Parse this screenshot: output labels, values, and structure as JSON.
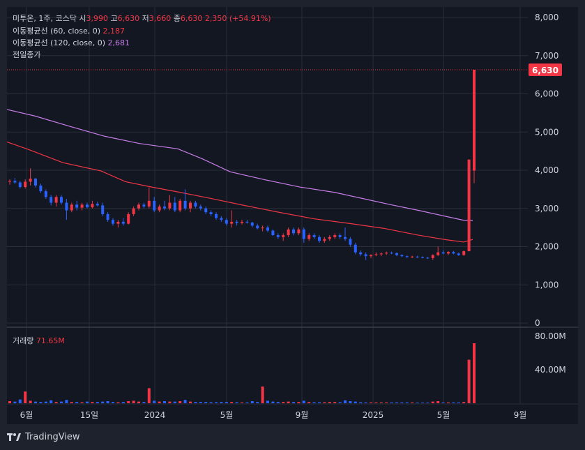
{
  "legend": {
    "symbol": "미투온, 1주, 코스닥",
    "o_label": "시",
    "o": "3,990",
    "h_label": "고",
    "h": "6,630",
    "l_label": "저",
    "l": "3,660",
    "c_label": "종",
    "c": "6,630",
    "change": "2,350 (+54.91%)",
    "ma60_label": "이동평균선 (60, close, 0)",
    "ma60_value": "2,187",
    "ma120_label": "이동평균선 (120, close, 0)",
    "ma120_value": "2,681",
    "prev_close_label": "전일종가",
    "volume_label": "거래량",
    "volume_value": "71.65M"
  },
  "price_badge": "6,630",
  "branding": "TradingView",
  "colors": {
    "background": "#1e222d",
    "pane": "#131722",
    "up": "#f23645",
    "down": "#2962ff",
    "ma60": "#f23645",
    "ma120": "#c77ee8",
    "text": "#d1d4dc"
  },
  "chart_data": {
    "type": "candlestick",
    "timeframe": "1주",
    "price_axis": {
      "ticks": [
        "8,000",
        "7,000",
        "6,000",
        "5,000",
        "4,000",
        "3,000",
        "2,000",
        "1,000",
        "0"
      ],
      "ylim": [
        0,
        8000
      ]
    },
    "volume_axis": {
      "ticks": [
        "80.00M",
        "40.00M"
      ]
    },
    "time_axis": {
      "ticks": [
        "6월",
        "15일",
        "2024",
        "5월",
        "9월",
        "2025",
        "5월",
        "9월"
      ]
    },
    "price_line": 6630,
    "ohlc": [
      [
        3700,
        3760,
        3620,
        3720
      ],
      [
        3720,
        3800,
        3640,
        3680
      ],
      [
        3680,
        3720,
        3520,
        3560
      ],
      [
        3560,
        3760,
        3520,
        3700
      ],
      [
        3700,
        4050,
        3600,
        3780
      ],
      [
        3780,
        3800,
        3550,
        3600
      ],
      [
        3600,
        3650,
        3400,
        3450
      ],
      [
        3450,
        3500,
        3250,
        3300
      ],
      [
        3300,
        3350,
        3080,
        3150
      ],
      [
        3150,
        3350,
        3050,
        3300
      ],
      [
        3300,
        3350,
        3100,
        3150
      ],
      [
        3150,
        3250,
        2700,
        2950
      ],
      [
        2950,
        3150,
        2900,
        3100
      ],
      [
        3100,
        3200,
        2950,
        3020
      ],
      [
        3020,
        3150,
        2950,
        3100
      ],
      [
        3100,
        3150,
        3000,
        3030
      ],
      [
        3030,
        3200,
        3000,
        3120
      ],
      [
        3120,
        3180,
        3050,
        3080
      ],
      [
        3080,
        3150,
        2800,
        2850
      ],
      [
        2850,
        2900,
        2650,
        2700
      ],
      [
        2700,
        2750,
        2550,
        2600
      ],
      [
        2600,
        2700,
        2500,
        2650
      ],
      [
        2650,
        2750,
        2550,
        2600
      ],
      [
        2600,
        2900,
        2580,
        2850
      ],
      [
        2850,
        3050,
        2800,
        3000
      ],
      [
        3000,
        3150,
        2950,
        3100
      ],
      [
        3100,
        3150,
        3000,
        3050
      ],
      [
        3050,
        3550,
        3000,
        3200
      ],
      [
        3200,
        3300,
        2900,
        2950
      ],
      [
        2950,
        3100,
        2900,
        3050
      ],
      [
        3050,
        3200,
        2950,
        3000
      ],
      [
        3000,
        3350,
        2950,
        3150
      ],
      [
        3150,
        3300,
        2900,
        2950
      ],
      [
        2950,
        3250,
        2900,
        3200
      ],
      [
        3200,
        3500,
        2950,
        3000
      ],
      [
        3000,
        3200,
        2900,
        3150
      ],
      [
        3150,
        3200,
        3000,
        3050
      ],
      [
        3050,
        3100,
        2950,
        3000
      ],
      [
        3000,
        3050,
        2850,
        2900
      ],
      [
        2900,
        2950,
        2800,
        2850
      ],
      [
        2850,
        2900,
        2700,
        2750
      ],
      [
        2750,
        2800,
        2650,
        2700
      ],
      [
        2700,
        2750,
        2550,
        2600
      ],
      [
        2600,
        2950,
        2500,
        2650
      ],
      [
        2650,
        2700,
        2550,
        2620
      ],
      [
        2620,
        2700,
        2580,
        2650
      ],
      [
        2650,
        2700,
        2600,
        2630
      ],
      [
        2630,
        2650,
        2500,
        2550
      ],
      [
        2550,
        2600,
        2450,
        2480
      ],
      [
        2480,
        2550,
        2400,
        2500
      ],
      [
        2500,
        2550,
        2380,
        2420
      ],
      [
        2420,
        2450,
        2280,
        2300
      ],
      [
        2300,
        2350,
        2200,
        2250
      ],
      [
        2250,
        2350,
        2150,
        2300
      ],
      [
        2300,
        2500,
        2250,
        2450
      ],
      [
        2450,
        2500,
        2300,
        2350
      ],
      [
        2350,
        2500,
        2300,
        2450
      ],
      [
        2450,
        2500,
        2100,
        2200
      ],
      [
        2200,
        2350,
        2150,
        2300
      ],
      [
        2300,
        2350,
        2200,
        2250
      ],
      [
        2250,
        2300,
        2100,
        2150
      ],
      [
        2150,
        2250,
        2100,
        2200
      ],
      [
        2200,
        2300,
        2150,
        2250
      ],
      [
        2250,
        2350,
        2200,
        2300
      ],
      [
        2300,
        2350,
        2200,
        2250
      ],
      [
        2250,
        2500,
        2150,
        2200
      ],
      [
        2200,
        2250,
        2000,
        2050
      ],
      [
        2050,
        2100,
        1800,
        1850
      ],
      [
        1850,
        1900,
        1750,
        1800
      ],
      [
        1800,
        1850,
        1650,
        1750
      ],
      [
        1750,
        1800,
        1700,
        1780
      ],
      [
        1780,
        1850,
        1750,
        1800
      ],
      [
        1800,
        1850,
        1750,
        1820
      ],
      [
        1820,
        1870,
        1780,
        1840
      ],
      [
        1840,
        1870,
        1800,
        1830
      ],
      [
        1830,
        1850,
        1750,
        1780
      ],
      [
        1780,
        1800,
        1720,
        1750
      ],
      [
        1750,
        1770,
        1700,
        1730
      ],
      [
        1730,
        1760,
        1700,
        1740
      ],
      [
        1740,
        1760,
        1700,
        1720
      ],
      [
        1720,
        1750,
        1690,
        1710
      ],
      [
        1710,
        1730,
        1680,
        1700
      ],
      [
        1700,
        1800,
        1650,
        1780
      ],
      [
        1780,
        2000,
        1750,
        1850
      ],
      [
        1850,
        1900,
        1800,
        1820
      ],
      [
        1820,
        1880,
        1780,
        1860
      ],
      [
        1860,
        1890,
        1800,
        1820
      ],
      [
        1820,
        1850,
        1760,
        1780
      ],
      [
        1780,
        1900,
        1760,
        1880
      ],
      [
        1880,
        4280,
        1880,
        4280
      ],
      [
        3990,
        6630,
        3660,
        6630
      ]
    ],
    "volume_millions": [
      2.5,
      2.0,
      4.5,
      14.0,
      3.0,
      2.0,
      1.5,
      2.0,
      3.5,
      1.5,
      2.0,
      4.0,
      1.5,
      1.5,
      1.2,
      2.0,
      1.5,
      1.5,
      2.0,
      2.5,
      1.5,
      1.2,
      1.5,
      2.5,
      3.0,
      2.0,
      1.5,
      18.0,
      3.0,
      2.0,
      2.5,
      2.0,
      2.0,
      2.5,
      4.0,
      2.0,
      1.5,
      1.5,
      1.5,
      1.2,
      1.2,
      1.5,
      1.5,
      1.5,
      1.2,
      1.0,
      1.0,
      2.5,
      1.5,
      20.0,
      3.0,
      2.0,
      1.5,
      1.5,
      2.0,
      1.5,
      1.5,
      3.0,
      1.5,
      1.2,
      1.2,
      1.2,
      1.5,
      1.5,
      1.2,
      3.5,
      2.5,
      2.0,
      1.2,
      1.0,
      1.0,
      1.0,
      1.0,
      1.0,
      1.0,
      1.0,
      1.0,
      1.0,
      1.0,
      0.8,
      0.8,
      0.8,
      2.0,
      2.5,
      1.0,
      1.0,
      1.0,
      1.0,
      1.5,
      52.0,
      71.65
    ],
    "ma60": [
      [
        10,
        4740
      ],
      [
        40,
        4550
      ],
      [
        90,
        4200
      ],
      [
        145,
        3980
      ],
      [
        180,
        3700
      ],
      [
        220,
        3550
      ],
      [
        250,
        3450
      ],
      [
        300,
        3270
      ],
      [
        350,
        3080
      ],
      [
        400,
        2900
      ],
      [
        450,
        2730
      ],
      [
        500,
        2610
      ],
      [
        550,
        2480
      ],
      [
        600,
        2300
      ],
      [
        640,
        2180
      ],
      [
        665,
        2120
      ],
      [
        678,
        2187
      ]
    ],
    "ma120": [
      [
        10,
        5590
      ],
      [
        50,
        5420
      ],
      [
        100,
        5150
      ],
      [
        150,
        4890
      ],
      [
        200,
        4700
      ],
      [
        255,
        4560
      ],
      [
        290,
        4300
      ],
      [
        330,
        3960
      ],
      [
        380,
        3750
      ],
      [
        430,
        3560
      ],
      [
        480,
        3420
      ],
      [
        520,
        3260
      ],
      [
        560,
        3100
      ],
      [
        600,
        2950
      ],
      [
        640,
        2790
      ],
      [
        665,
        2690
      ],
      [
        678,
        2681
      ]
    ]
  }
}
